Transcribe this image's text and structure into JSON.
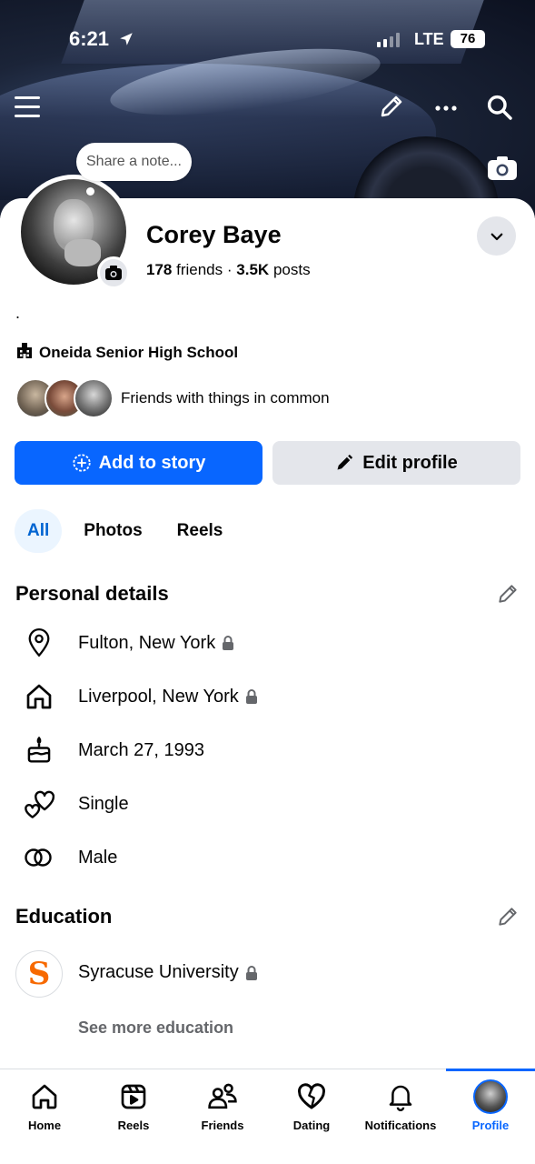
{
  "status_bar": {
    "time": "6:21",
    "network": "LTE",
    "battery": "76"
  },
  "profile": {
    "note_placeholder": "Share a note...",
    "name": "Corey Baye",
    "friends_count": "178",
    "friends_label": "friends",
    "separator": "·",
    "posts_count": "3.5K",
    "posts_label": "posts",
    "bio": ".",
    "school": "Oneida Senior High School",
    "friends_in_common": "Friends with things in common"
  },
  "actions": {
    "add_story": "Add to story",
    "edit_profile": "Edit profile"
  },
  "tabs": [
    {
      "label": "All",
      "active": true
    },
    {
      "label": "Photos",
      "active": false
    },
    {
      "label": "Reels",
      "active": false
    }
  ],
  "personal_details": {
    "title": "Personal details",
    "items": [
      {
        "icon": "location-pin-icon",
        "text": "Fulton, New York",
        "private": true
      },
      {
        "icon": "home-icon",
        "text": "Liverpool, New York",
        "private": true
      },
      {
        "icon": "birthday-cake-icon",
        "text": "March 27, 1993",
        "private": false
      },
      {
        "icon": "relationship-hearts-icon",
        "text": "Single",
        "private": false
      },
      {
        "icon": "gender-rings-icon",
        "text": "Male",
        "private": false
      }
    ]
  },
  "education": {
    "title": "Education",
    "school": "Syracuse University",
    "logo_letter": "S",
    "private": true,
    "see_more": "See more education"
  },
  "bottom_nav": [
    {
      "label": "Home",
      "icon": "home-icon",
      "active": false
    },
    {
      "label": "Reels",
      "icon": "reels-icon",
      "active": false
    },
    {
      "label": "Friends",
      "icon": "friends-icon",
      "active": false
    },
    {
      "label": "Dating",
      "icon": "dating-heart-icon",
      "active": false
    },
    {
      "label": "Notifications",
      "icon": "bell-icon",
      "active": false
    },
    {
      "label": "Profile",
      "icon": "profile-avatar",
      "active": true
    }
  ],
  "colors": {
    "accent": "#0866ff",
    "tab_active_bg": "#ebf5ff",
    "secondary_button": "#e4e6eb",
    "syracuse_orange": "#f76900"
  }
}
